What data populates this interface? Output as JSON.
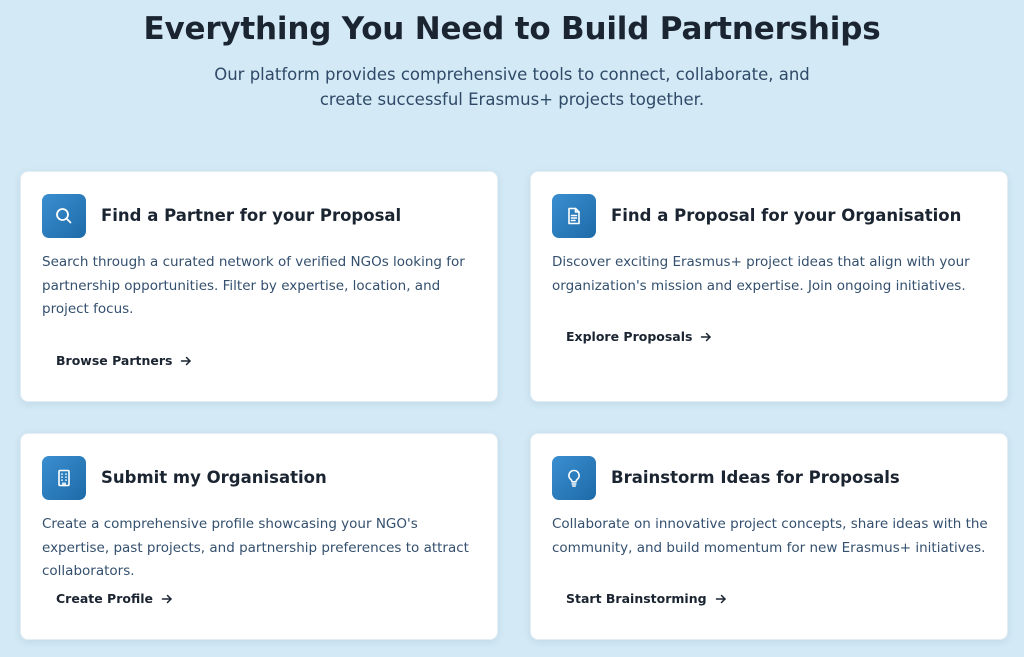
{
  "hero": {
    "title": "Everything You Need to Build Partnerships",
    "subtitle": "Our platform provides comprehensive tools to connect, collaborate, and create successful Erasmus+ projects together."
  },
  "colors": {
    "background": "#d3e9f5",
    "accent": "#2a7cbf",
    "card": "#ffffff"
  },
  "features": [
    {
      "icon": "search-icon",
      "title": "Find a Partner for your Proposal",
      "description": "Search through a curated network of verified NGOs looking for partnership opportunities. Filter by expertise, location, and project focus.",
      "link_label": "Browse Partners"
    },
    {
      "icon": "document-icon",
      "title": "Find a Proposal for your Organisation",
      "description": "Discover exciting Erasmus+ project ideas that align with your organization's mission and expertise. Join ongoing initiatives.",
      "link_label": "Explore Proposals"
    },
    {
      "icon": "building-icon",
      "title": "Submit my Organisation",
      "description": "Create a comprehensive profile showcasing your NGO's expertise, past projects, and partnership preferences to attract collaborators.",
      "link_label": "Create Profile"
    },
    {
      "icon": "lightbulb-icon",
      "title": "Brainstorm Ideas for Proposals",
      "description": "Collaborate on innovative project concepts, share ideas with the community, and build momentum for new Erasmus+ initiatives.",
      "link_label": "Start Brainstorming"
    }
  ]
}
